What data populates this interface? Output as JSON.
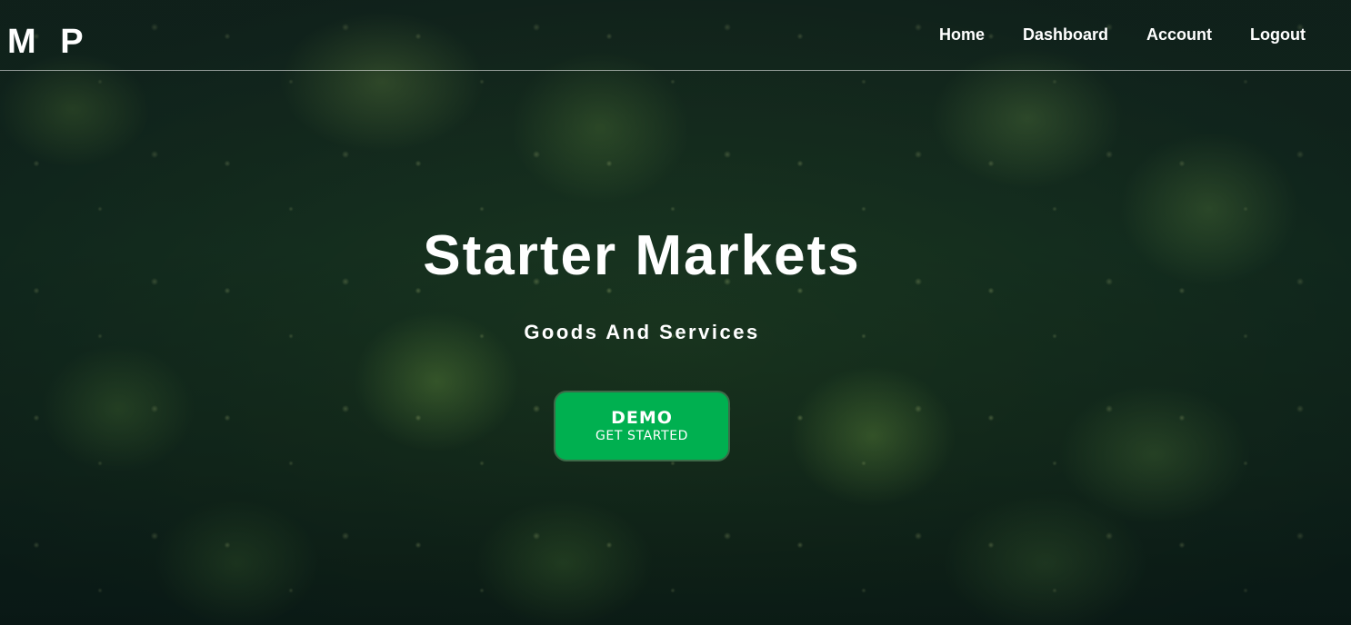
{
  "brand": {
    "logo_text": "M P"
  },
  "nav": {
    "items": [
      {
        "label": "Home"
      },
      {
        "label": "Dashboard"
      },
      {
        "label": "Account"
      },
      {
        "label": "Logout"
      }
    ]
  },
  "hero": {
    "title": "Starter Markets",
    "subtitle": "Goods And Services",
    "background": "green leaves with water droplets",
    "cta": {
      "main_label": "DEMO",
      "sub_label": "GET STARTED",
      "color": "#00b050"
    }
  }
}
